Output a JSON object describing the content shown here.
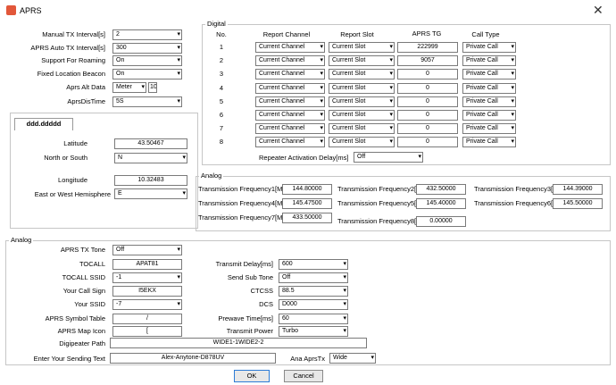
{
  "window": {
    "title": "APRS",
    "close_glyph": "✕",
    "app_icon": "aprs-app-icon"
  },
  "general": [
    {
      "label": "Manual TX Interval[s]",
      "value": "2"
    },
    {
      "label": "APRS Auto TX Interval[s]",
      "value": "300"
    },
    {
      "label": "Support For Roaming",
      "value": "On"
    },
    {
      "label": "Fixed Location Beacon",
      "value": "On"
    },
    {
      "label": "Aprs Alt Data",
      "value": "Meter",
      "extra": "10"
    },
    {
      "label": "AprsDisTime",
      "value": "5S"
    }
  ],
  "location": {
    "tab": "ddd.ddddd",
    "latitude_label": "Latitude",
    "latitude": "43.50467",
    "ns_label": "North or South",
    "ns": "N",
    "longitude_label": "Longitude",
    "longitude": "10.32483",
    "ew_label": "East or West Hemisphere",
    "ew": "E"
  },
  "digital": {
    "title": "Digital",
    "headers": [
      "No.",
      "Report Channel",
      "Report Slot",
      "APRS TG",
      "Call Type"
    ],
    "rows": [
      {
        "no": "1",
        "channel": "Current Channel",
        "slot": "Current Slot",
        "tg": "222999",
        "call": "Private Call"
      },
      {
        "no": "2",
        "channel": "Current Channel",
        "slot": "Current Slot",
        "tg": "9057",
        "call": "Private Call"
      },
      {
        "no": "3",
        "channel": "Current Channel",
        "slot": "Current Slot",
        "tg": "0",
        "call": "Private Call"
      },
      {
        "no": "4",
        "channel": "Current Channel",
        "slot": "Current Slot",
        "tg": "0",
        "call": "Private Call"
      },
      {
        "no": "5",
        "channel": "Current Channel",
        "slot": "Current Slot",
        "tg": "0",
        "call": "Private Call"
      },
      {
        "no": "6",
        "channel": "Current Channel",
        "slot": "Current Slot",
        "tg": "0",
        "call": "Private Call"
      },
      {
        "no": "7",
        "channel": "Current Channel",
        "slot": "Current Slot",
        "tg": "0",
        "call": "Private Call"
      },
      {
        "no": "8",
        "channel": "Current Channel",
        "slot": "Current Slot",
        "tg": "0",
        "call": "Private Call"
      }
    ],
    "repeater_label": "Repeater Activation Delay[ms]",
    "repeater_value": "Off"
  },
  "freq": {
    "title": "Analog",
    "items": [
      {
        "label": "Transmission Frequency1[MHz]",
        "value": "144.80000"
      },
      {
        "label": "Transmission Frequency2[MHz]",
        "value": "432.50000"
      },
      {
        "label": "Transmission Frequency3[MHz]",
        "value": "144.39000"
      },
      {
        "label": "Transmission Frequency4[MHz]",
        "value": "145.47500"
      },
      {
        "label": "Transmission Frequency5[MHz]",
        "value": "145.40000"
      },
      {
        "label": "Transmission Frequency6[MHz]",
        "value": "145.50000"
      },
      {
        "label": "Transmission Frequency7[MHz]",
        "value": "433.50000"
      },
      {
        "label": "Transmission Frequency8[MHz]",
        "value": "0.00000"
      }
    ]
  },
  "analog": {
    "title": "Analog",
    "left": [
      {
        "label": "APRS TX Tone",
        "value": "Off",
        "kind": "select"
      },
      {
        "label": "TOCALL",
        "value": "APAT81",
        "kind": "input"
      },
      {
        "label": "TOCALL SSID",
        "value": "-1",
        "kind": "select"
      },
      {
        "label": "Your Call Sign",
        "value": "I5EKX",
        "kind": "input"
      },
      {
        "label": "Your SSID",
        "value": "-7",
        "kind": "select"
      },
      {
        "label": "APRS Symbol Table",
        "value": "/",
        "kind": "input"
      },
      {
        "label": "APRS Map Icon",
        "value": "[",
        "kind": "input"
      }
    ],
    "right": [
      {
        "label": "Transmit Delay[ms]",
        "value": "600"
      },
      {
        "label": "Send Sub Tone",
        "value": "Off"
      },
      {
        "label": "CTCSS",
        "value": "88.5"
      },
      {
        "label": "DCS",
        "value": "D000"
      },
      {
        "label": "Prewave Time[ms]",
        "value": "60"
      },
      {
        "label": "Transmit Power",
        "value": "Turbo"
      }
    ],
    "digi_label": "Digipeater Path",
    "digi_value": "WIDE1-1WIDE2-2",
    "send_label": "Enter Your Sending Text",
    "send_value": "Alex-Anytone-D878UV",
    "ana_label": "Ana AprsTx",
    "ana_value": "Wide"
  },
  "buttons": {
    "ok": "OK",
    "cancel": "Cancel"
  }
}
